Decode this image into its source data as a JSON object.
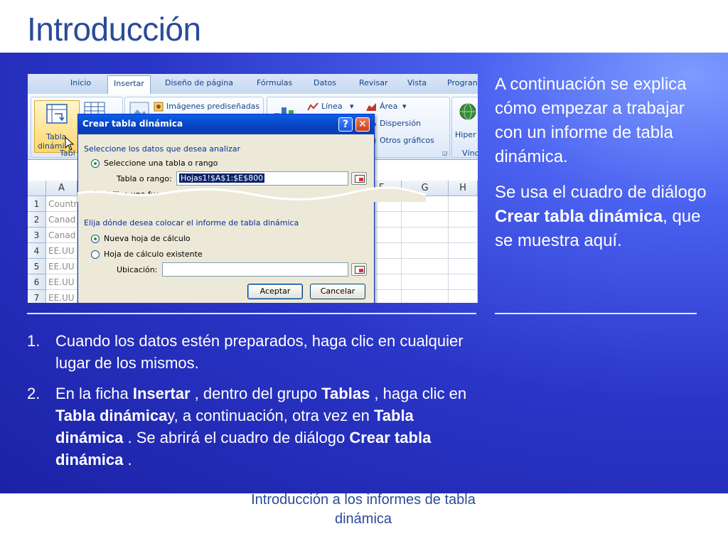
{
  "slide": {
    "title": "Introducción",
    "right_para1": "A continuación se explica cómo empezar a trabajar con un informe de tabla dinámica.",
    "right_para2_a": "Se usa el cuadro de diálogo ",
    "right_para2_bold": "Crear tabla dinámica",
    "right_para2_b": ", que se muestra aquí.",
    "steps": [
      {
        "num": "1.",
        "text": "Cuando los datos estén preparados, haga clic en cualquier lugar de los mismos."
      },
      {
        "num": "2.",
        "t1": "En la ficha ",
        "b1": "Insertar",
        "t2": " , dentro del grupo ",
        "b2": "Tablas",
        "t3": " , haga clic en ",
        "b3": "Tabla dinámica",
        "t4": "y, a continuación, otra vez en ",
        "b4": "Tabla dinámica",
        "t5": " . Se abrirá el cuadro de diálogo ",
        "b5": "Crear tabla dinámica",
        "t6": " ."
      }
    ],
    "footer": "Introducción a los informes de tabla dinámica"
  },
  "ribbon": {
    "tabs": [
      "Inicio",
      "Insertar",
      "Diseño de página",
      "Fórmulas",
      "Datos",
      "Revisar",
      "Vista",
      "Progran"
    ],
    "active_tab": "Insertar",
    "pivot_label_1": "Tabla",
    "pivot_label_2": "dinámi",
    "group_label": "Tabl",
    "clipart": "Imágenes prediseñadas",
    "line": "Línea",
    "area": "Área",
    "scatter": "Dispersión",
    "other": "Otros gráficos",
    "hyperlink": "Hiper",
    "vinc": "Vínc"
  },
  "grid": {
    "columns": [
      "A",
      "F",
      "G",
      "H"
    ],
    "rows": [
      "1",
      "2",
      "3",
      "4",
      "5",
      "6",
      "7"
    ],
    "colA_values": [
      "Country",
      "Canad",
      "Canad",
      "EE.UU",
      "EE.UU",
      "EE.UU",
      "EE.UU"
    ]
  },
  "dialog": {
    "title": "Crear tabla dinámica",
    "help": "?",
    "close": "✕",
    "section1": "Seleccione los datos que desea analizar",
    "option1": "Seleccione una tabla o rango",
    "range_label": "Tabla o rango:",
    "range_value": "Hojas1!$A$1:$E$800",
    "option2": "Utilice una fuente de datos externa",
    "section2": "Elija dónde desea colocar el informe de tabla dinámica",
    "option3": "Nueva hoja de cálculo",
    "option4": "Hoja de cálculo existente",
    "location_label": "Ubicación:",
    "location_value": "",
    "ok": "Aceptar",
    "cancel": "Cancelar"
  },
  "colors": {
    "accent": "#2b4a9a",
    "panel": "#2a36c8",
    "dialog_title": "#0842c0"
  }
}
